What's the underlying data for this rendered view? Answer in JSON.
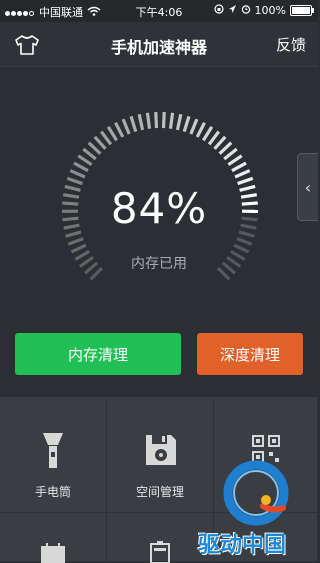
{
  "status": {
    "carrier": "中国联通",
    "time": "下午4:06",
    "battery": "100%"
  },
  "navbar": {
    "title": "手机加速神器",
    "feedback": "反馈"
  },
  "gauge": {
    "percent": "84%",
    "label": "内存已用",
    "fill_fraction": 0.84
  },
  "buttons": {
    "memory_clean": "内存清理",
    "deep_clean": "深度清理"
  },
  "tools": [
    {
      "label": "手电筒",
      "icon": "flashlight-icon"
    },
    {
      "label": "空间管理",
      "icon": "disk-icon"
    },
    {
      "label": "",
      "icon": "qr-code-icon"
    },
    {
      "label": "",
      "icon": "calendar-icon"
    },
    {
      "label": "",
      "icon": "battery-icon"
    },
    {
      "label": "",
      "icon": "unknown-icon"
    }
  ],
  "watermark": "驱动中国",
  "colors": {
    "green": "#22bf57",
    "orange": "#e0622a",
    "background": "#2b2f33"
  }
}
